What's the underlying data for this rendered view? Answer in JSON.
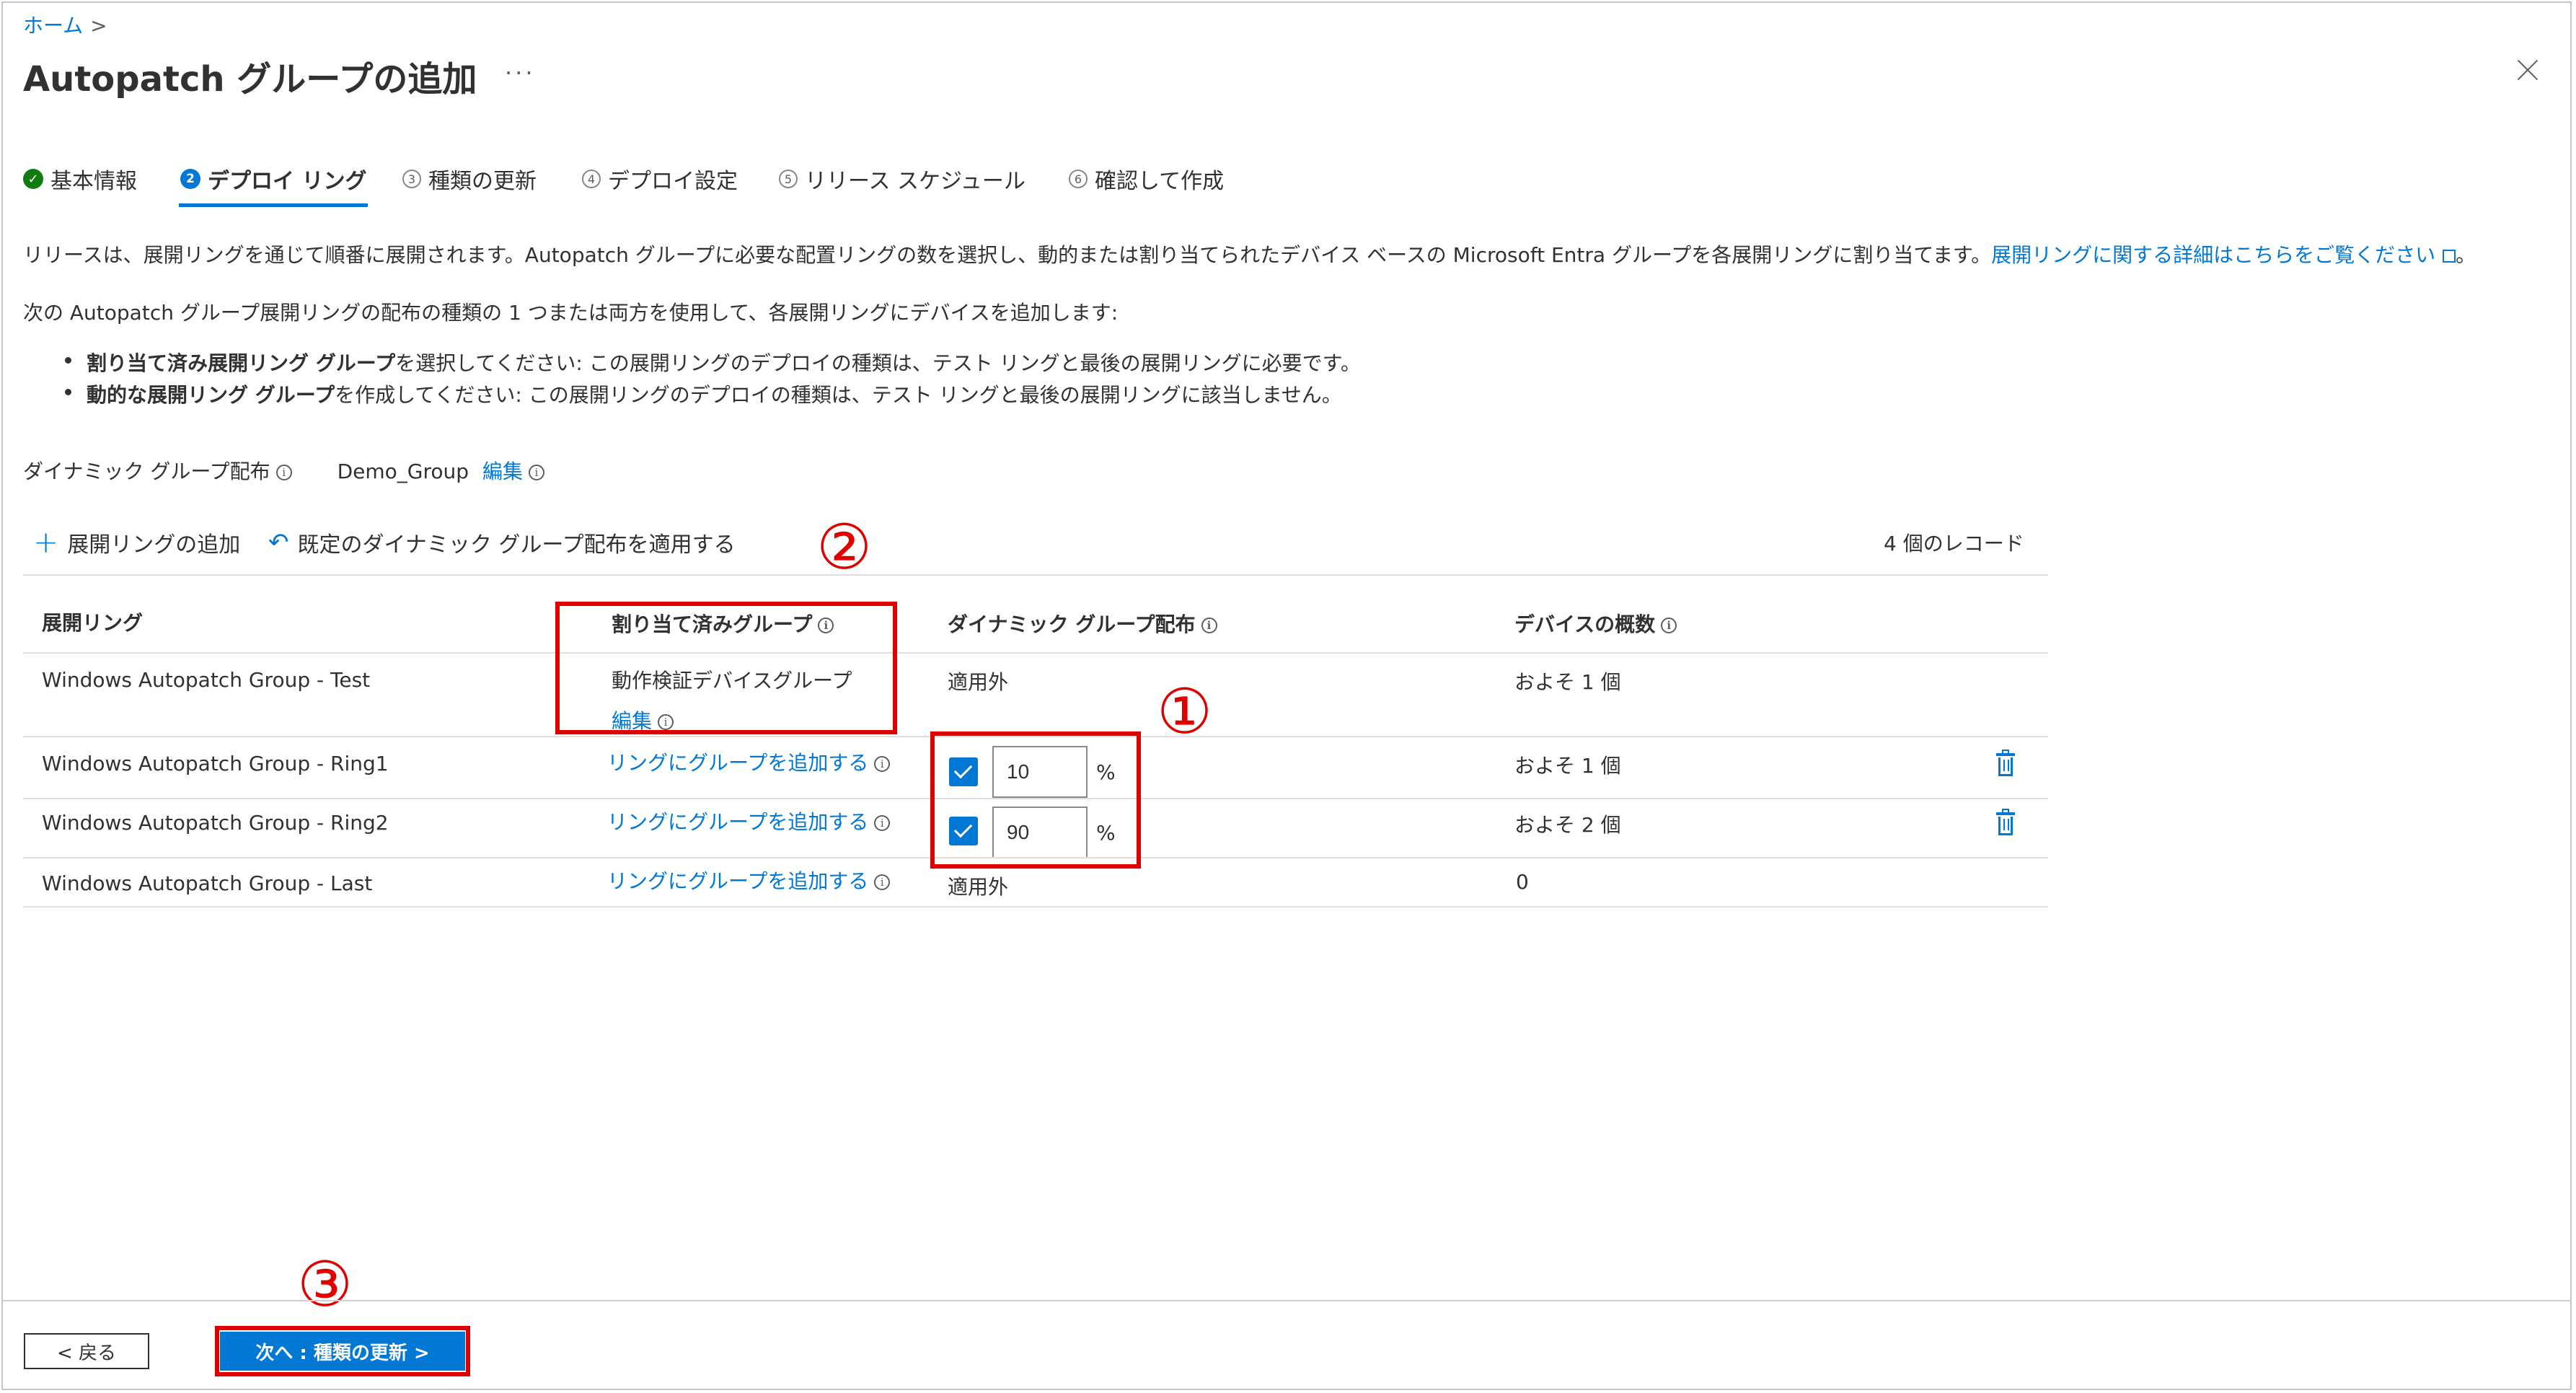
{
  "breadcrumb": {
    "home": "ホーム",
    "separator": ">"
  },
  "page": {
    "title": "Autopatch グループの追加",
    "more": "···"
  },
  "tabs": [
    {
      "label": "基本情報",
      "step": "✓",
      "state": "done"
    },
    {
      "label": "デプロイ リング",
      "step": "2",
      "state": "active"
    },
    {
      "label": "種類の更新",
      "step": "3",
      "state": "pending"
    },
    {
      "label": "デプロイ設定",
      "step": "4",
      "state": "pending"
    },
    {
      "label": "リリース スケジュール",
      "step": "5",
      "state": "pending"
    },
    {
      "label": "確認して作成",
      "step": "6",
      "state": "pending"
    }
  ],
  "intro": {
    "text": "リリースは、展開リングを通じて順番に展開されます。Autopatch グループに必要な配置リングの数を選択し、動的または割り当てられたデバイス ベースの Microsoft Entra グループを各展開リングに割り当てます。",
    "link": "展開リングに関する詳細はこちらをご覧ください",
    "end": "。"
  },
  "instructions": {
    "lead": "次の Autopatch グループ展開リングの配布の種類の 1 つまたは両方を使用して、各展開リングにデバイスを追加します:",
    "bullet1_bold": "割り当て済み展開リング グループ",
    "bullet1_rest": "を選択してください: この展開リングのデプロイの種類は、テスト リングと最後の展開リングに必要です。",
    "bullet2_bold": "動的な展開リング グループ",
    "bullet2_rest": "を作成してください: この展開リングのデプロイの種類は、テスト リングと最後の展開リングに該当しません。"
  },
  "dynamic_distribution": {
    "label": "ダイナミック グループ配布",
    "group": "Demo_Group",
    "edit": "編集"
  },
  "toolbar": {
    "add_ring": "展開リングの追加",
    "apply_default": "既定のダイナミック グループ配布を適用する",
    "record_count": "4 個のレコード"
  },
  "table": {
    "headers": {
      "ring": "展開リング",
      "assigned": "割り当て済みグループ",
      "dynamic": "ダイナミック グループ配布",
      "devices": "デバイスの概数"
    },
    "rows": [
      {
        "ring": "Windows Autopatch Group - Test",
        "assigned": "動作検証デバイスグループ",
        "assigned_edit": "編集",
        "dynamic": "適用外",
        "devices": "およそ 1 個"
      },
      {
        "ring": "Windows Autopatch Group - Ring1",
        "assigned_link": "リングにグループを追加する",
        "percent": "10",
        "unit": "%",
        "devices": "およそ 1 個"
      },
      {
        "ring": "Windows Autopatch Group - Ring2",
        "assigned_link": "リングにグループを追加する",
        "percent": "90",
        "unit": "%",
        "devices": "およそ 2 個"
      },
      {
        "ring": "Windows Autopatch Group - Last",
        "assigned_link": "リングにグループを追加する",
        "dynamic": "適用外",
        "devices": "0"
      }
    ]
  },
  "annotations": {
    "m1": "①",
    "m2": "②",
    "m3": "③",
    "color": "#e00000"
  },
  "footer": {
    "back": "< 戻る",
    "next": "次へ : 種類の更新 >"
  },
  "colors": {
    "accent": "#0078d4",
    "success": "#107c10",
    "text": "#323130"
  }
}
